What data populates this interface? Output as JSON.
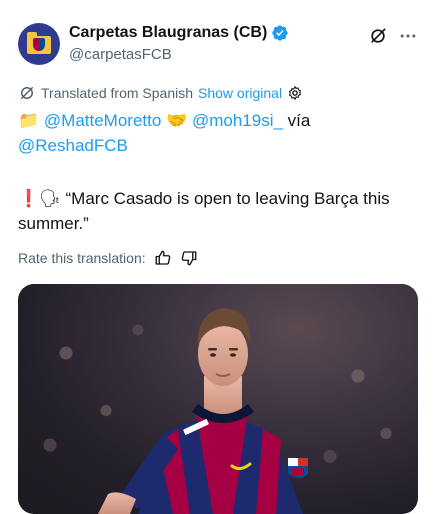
{
  "header": {
    "display_name": "Carpetas Blaugranas (CB)",
    "handle": "@carpetasFCB"
  },
  "translation": {
    "label": "Translated from Spanish",
    "show_original": "Show original"
  },
  "tweet": {
    "line1_mention1": "@MatteMoretto",
    "line1_mention2": "@moh19si_",
    "line1_via": "vía",
    "line2_mention": "@ReshadFCB",
    "quote_line1": "“Marc Casado is open to leaving Barça this",
    "quote_line2": "summer.”",
    "emoji_folder": "📁",
    "emoji_handshake": "🤝",
    "emoji_exclamation": "❗",
    "emoji_speaking": "🗣"
  },
  "rate": {
    "label": "Rate this translation:"
  },
  "colors": {
    "link": "#1d9bf0",
    "secondary": "#536471",
    "verified": "#1d9bf0"
  },
  "icons": [
    "verified-badge-icon",
    "grok-icon",
    "more-icon",
    "translate-icon",
    "settings-icon",
    "thumbs-up-icon",
    "thumbs-down-icon"
  ]
}
